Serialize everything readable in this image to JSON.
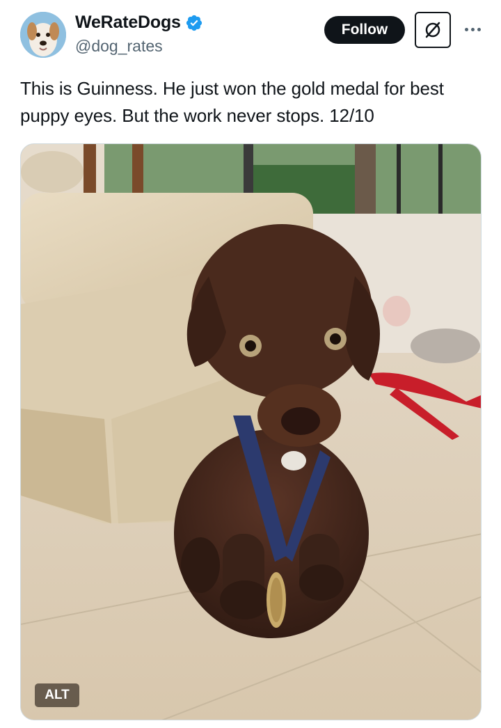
{
  "author": {
    "display_name": "WeRateDogs",
    "handle": "@dog_rates",
    "verified": true,
    "avatar_icon": "dog-avatar",
    "verified_color": "#1d9bf0"
  },
  "actions": {
    "follow_label": "Follow",
    "grok_icon": "slashed-circle-icon",
    "more_icon": "more-horizontal-icon"
  },
  "tweet": {
    "text": "This is Guinness. He just won the gold medal for best puppy eyes. But the work never stops. 12/10"
  },
  "media": {
    "alt_label": "ALT"
  },
  "colors": {
    "follow_bg": "#0f1419",
    "text": "#0f1419",
    "muted": "#536471",
    "accent": "#1d9bf0"
  }
}
